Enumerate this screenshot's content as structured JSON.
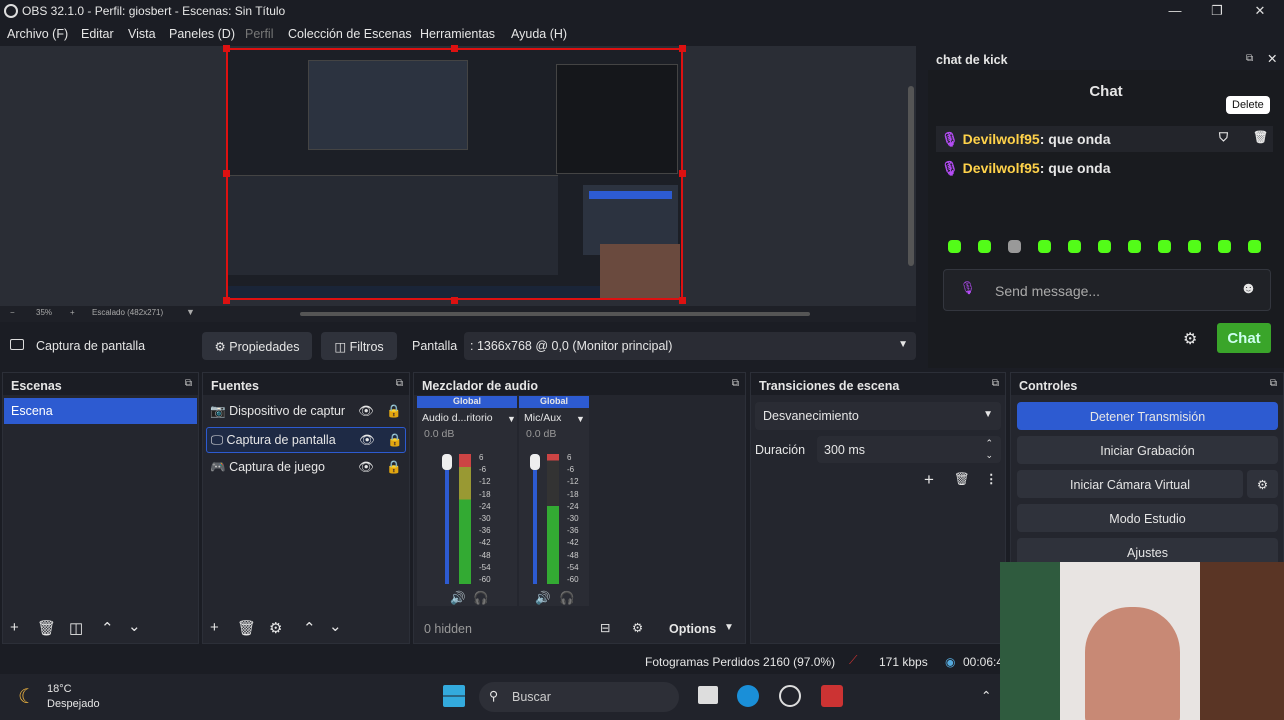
{
  "window": {
    "title": "OBS 32.1.0 - Perfil: giosbert - Escenas: Sin Título",
    "minimize": "—",
    "maximize": "❐",
    "close": "✕"
  },
  "menu": [
    "Archivo (F)",
    "Editar",
    "Vista",
    "Paneles (D)",
    "Perfil",
    "Colección de Escenas",
    "Herramientas",
    "Ayuda (H)"
  ],
  "preview": {
    "zoom": "35%",
    "scale": "Escalado (482x271)",
    "minus": "−",
    "plus": "+"
  },
  "scenebar": {
    "source_label": "Captura de pantalla",
    "properties": "Propiedades",
    "filters": "Filtros",
    "display_label": "Pantalla",
    "display_value": ": 1366x768 @ 0,0 (Monitor principal)"
  },
  "scenes": {
    "title": "Escenas",
    "items": [
      "Escena"
    ]
  },
  "sources": {
    "title": "Fuentes",
    "items": [
      {
        "label": "Dispositivo de captur",
        "icon": "camera-icon"
      },
      {
        "label": "Captura de pantalla",
        "icon": "monitor-icon"
      },
      {
        "label": "Captura de juego",
        "icon": "gamepad-icon"
      }
    ]
  },
  "mixer": {
    "title": "Mezclador de audio",
    "channels": [
      {
        "global": "Global",
        "name": "Audio d...ritorio",
        "db": "0.0 dB"
      },
      {
        "global": "Global",
        "name": "Mic/Aux",
        "db": "0.0 dB"
      }
    ],
    "scale": [
      "6",
      "-6",
      "-12",
      "-18",
      "-24",
      "-30",
      "-36",
      "-42",
      "-48",
      "-54",
      "-60"
    ],
    "hidden": "0 hidden",
    "options": "Options"
  },
  "transitions": {
    "title": "Transiciones de escena",
    "selected": "Desvanecimiento",
    "duration_label": "Duración",
    "duration_value": "300 ms"
  },
  "controls": {
    "title": "Controles",
    "stop_stream": "Detener Transmisión",
    "start_rec": "Iniciar Grabación",
    "virtual_cam": "Iniciar Cámara Virtual",
    "studio": "Modo Estudio",
    "settings": "Ajustes"
  },
  "chat": {
    "dock_title": "chat de kick",
    "header": "Chat",
    "tooltip": "Delete",
    "messages": [
      {
        "user": "Devilwolf95",
        "text": "que onda"
      },
      {
        "user": "Devilwolf95",
        "text": "que onda"
      }
    ],
    "placeholder": "Send message...",
    "send": "Chat"
  },
  "status": {
    "frames": "Fotogramas Perdidos 2160 (97.0%)",
    "kbps": "171 kbps",
    "time": "00:06:4"
  },
  "taskbar": {
    "temp": "18°C",
    "weather": "Despejado",
    "search": "Buscar"
  },
  "colors": {
    "accent": "#2d5bd1",
    "kick_green": "#53fc18",
    "record_red": "#d11"
  }
}
